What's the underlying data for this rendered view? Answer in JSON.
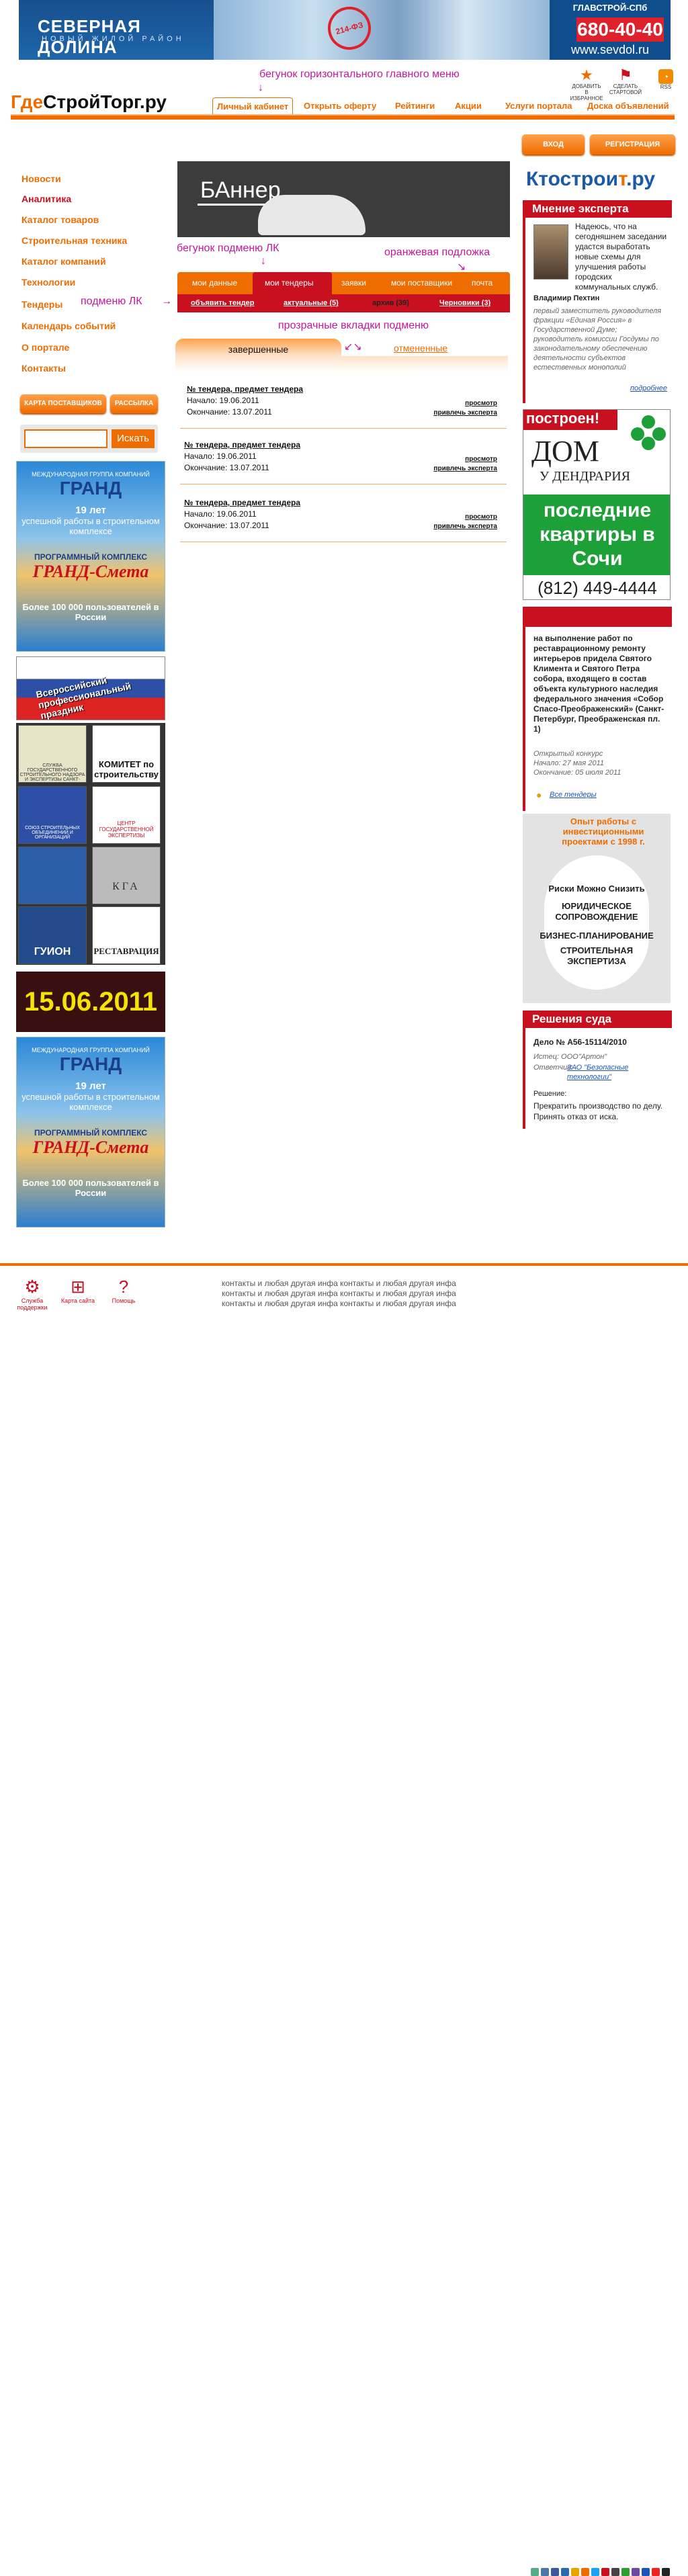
{
  "top_banner": {
    "title": "СЕВЕРНАЯ ДОЛИНА",
    "subtitle": "НОВЫЙ ЖИЛОЙ РАЙОН",
    "stamp": "214-ФЗ",
    "brand": "ГЛАВСТРОЙ-СПб",
    "phone": "680-40-40",
    "site": "www.sevdol.ru"
  },
  "notes": {
    "main_menu": "бегунок горизонтального главного меню",
    "lk_submenu_runner": "бегунок подменю ЛК",
    "orange_bg": "оранжевая подложка",
    "lk_submenu": "подменю ЛК",
    "transparent_tabs": "прозрачные вкладки подменю"
  },
  "logo": {
    "part1": "Где",
    "part2": "СтройТорг",
    "part3": ".ру"
  },
  "top_icons": [
    {
      "label": "ДОБАВИТЬ В ИЗБРАННОЕ"
    },
    {
      "label": "СДЕЛАТЬ СТАРТОВОЙ"
    },
    {
      "label": "RSS"
    }
  ],
  "main_menu": [
    "Личный кабинет",
    "Открыть оферту",
    "Рейтинги",
    "Акции",
    "Услуги портала",
    "Доска объявлений"
  ],
  "auth": {
    "login": "ВХОД",
    "register": "РЕГИСТРАЦИЯ"
  },
  "side_nav": [
    "Новости",
    "Аналитика",
    "Каталог товаров",
    "Строительная техника",
    "Каталог компаний",
    "Технологии",
    "Тендеры",
    "Календарь событий",
    "О портале",
    "Контакты"
  ],
  "side_buttons": {
    "suppliers_map": "КАРТА ПОСТАВЩИКОВ",
    "mailing": "РАССЫЛКА"
  },
  "search": {
    "button": "Искать",
    "value": ""
  },
  "left_ads": {
    "granda": {
      "head": "МЕЖДУНАРОДНАЯ ГРУППА КОМПАНИЙ",
      "name": "ГРАНД",
      "years": "19 лет",
      "years2": "успешной работы в строительном комплексе",
      "product": "ПРОГРАММНЫЙ КОМПЛЕКС",
      "smeta": "ГРАНД-Смета",
      "users": "Более 100 000 пользователей в России"
    },
    "holiday": "Всероссийский профессиональный праздник",
    "tiles": [
      "СЛУЖБА ГОСУДАРСТВЕННОГО СТРОИТЕЛЬНОГО НАДЗОРА И ЭКСПЕРТИЗЫ САНКТ-ПЕТЕРБУРГА",
      "КОМИТЕТ по строительству",
      "СОЮЗ СТРОИТЕЛЬНЫХ ОБЪЕДИНЕНИЙ И ОРГАНИЗАЦИЙ",
      "ЦЕНТР ГОСУДАРСТВЕННОЙ ЭКСПЕРТИЗЫ",
      "",
      "КГА",
      "ГУИОН",
      "РЕСТАВРАЦИЯ"
    ],
    "date": "15.06.2011"
  },
  "banner": {
    "text": "БАннер"
  },
  "lk_tabs": [
    "мои данные",
    "мои тендеры",
    "заявки",
    "мои поставщики",
    "почта"
  ],
  "lk_subtabs": {
    "announce": "объявить тендер",
    "current": "актуальные (5)",
    "archive": "архив (39)",
    "drafts": "Черновики (3)"
  },
  "content_tabs": {
    "finished": "завершенные",
    "cancelled": "отмененные"
  },
  "tenders": [
    {
      "title": "№ тендера, предмет тендера",
      "start": "Начало: 19.06.2011",
      "end": "Окончание: 13.07.2011",
      "view": "просмотр",
      "expert": "привлечь эксперта"
    },
    {
      "title": "№ тендера, предмет тендера",
      "start": "Начало: 19.06.2011",
      "end": "Окончание: 13.07.2011",
      "view": "просмотр",
      "expert": "привлечь эксперта"
    },
    {
      "title": "№ тендера, предмет тендера",
      "start": "Начало: 19.06.2011",
      "end": "Окончание: 13.07.2011",
      "view": "просмотр",
      "expert": "привлечь эксперта"
    }
  ],
  "right": {
    "ktostroit": "Ктострои",
    "ktostroit2": "т",
    "ktostroit3": ".ру",
    "expert": {
      "head": "Мнение эксперта",
      "quote": "Надеюсь, что на сегодняшнем заседании удастся выработать новые схемы для улучшения работы городских коммунальных служб.",
      "name": "Владимир Пехтин",
      "role": "первый заместитель руководителя фракции «Единая Россия» в Государственной Думе; руководитель комиссии Госдумы по законодательному обеспечению деятельности субъектов естественных монополий",
      "more": "подробнее"
    },
    "dom": {
      "badge": "построен!",
      "line1": "ДОМ",
      "line2": "У ДЕНДРАРИЯ",
      "green": "последние квартиры в Сочи",
      "phone": "(812) 449-4444"
    },
    "tender": {
      "text": "на выполнение работ по реставрационному ремонту интерьеров придела Святого Климента и Святого Петра собора, входящего в состав объекта культурного наследия федерального значения «Собор Спасо-Преображенский» (Санкт-Петербург, Преображенская пл. 1)",
      "type": "Открытый конкурс",
      "start": "Начало: 27 мая 2011",
      "end": "Окончание: 05 июля 2011",
      "all": "Все тендеры"
    },
    "exp_ad": {
      "head": "Опыт работы с инвестиционными проектами с 1998 г.",
      "rms": "Риски Можно Снизить",
      "l1": "ЮРИДИЧЕСКОЕ СОПРОВОЖДЕНИЕ",
      "l2": "БИЗНЕС-ПЛАНИРОВАНИЕ",
      "l3": "СТРОИТЕЛЬНАЯ ЭКСПЕРТИЗА"
    },
    "court": {
      "head": "Решения суда",
      "case": "Дело № А56-15114/2010",
      "plaintiff": "Истец: ООО\"Артон\"",
      "defendant_label": "Ответчик:",
      "defendant": "ЗАО \"Безопасные технологии\"",
      "decision_label": "Решение:",
      "decision": "Прекратить производство по делу. Принять отказ от иска."
    }
  },
  "footer": {
    "icons": [
      "Служба поддержки",
      "Карта сайта",
      "Помощь"
    ],
    "lines": [
      "контакты и любая другая инфа контакты и любая другая инфа",
      "контакты и любая другая инфа контакты и любая другая инфа",
      "контакты и любая другая инфа контакты и любая другая инфа"
    ]
  }
}
